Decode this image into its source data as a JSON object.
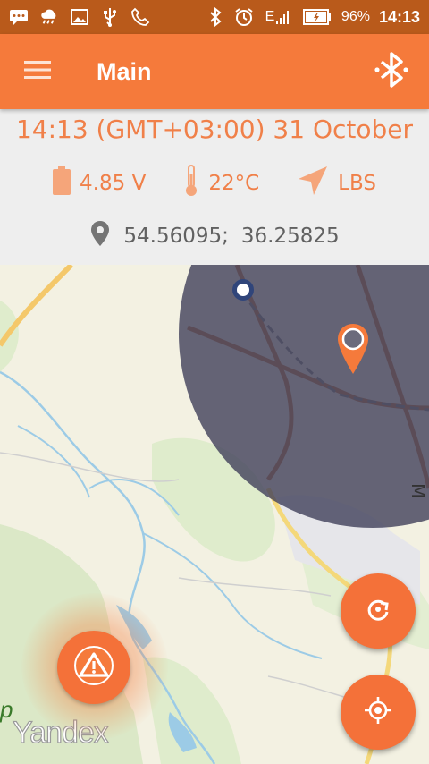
{
  "statusbar": {
    "battery_percent": "96%",
    "time": "14:13",
    "network": "E",
    "icons_left": [
      "message-icon",
      "weather-icon",
      "gallery-icon",
      "usb-icon",
      "call-icon"
    ],
    "icons_right": [
      "bluetooth-icon",
      "alarm-icon",
      "signal-icon",
      "battery-icon"
    ]
  },
  "appbar": {
    "title": "Main",
    "menu_icon": "menu-icon",
    "action_icon": "bluetooth-icon"
  },
  "info": {
    "datetime": "14:13 (GMT+03:00) 31 October",
    "voltage": "4.85 V",
    "temperature": "22°C",
    "location_source": "LBS",
    "lat": "54.56095;",
    "lon": "36.25825"
  },
  "map": {
    "provider_logo": "Yandex",
    "partial_label": "р",
    "accuracy_circle_color": "#4e4d63",
    "marker_color": "#f57a3b"
  },
  "buttons": {
    "refresh_icon": "refresh-icon",
    "locate_icon": "my-location-icon",
    "sos_icon": "warning-icon"
  },
  "colors": {
    "accent": "#f57a3b",
    "statusbar": "#b95a1b",
    "info_bg": "#eeeeee",
    "info_text": "#f08049"
  }
}
